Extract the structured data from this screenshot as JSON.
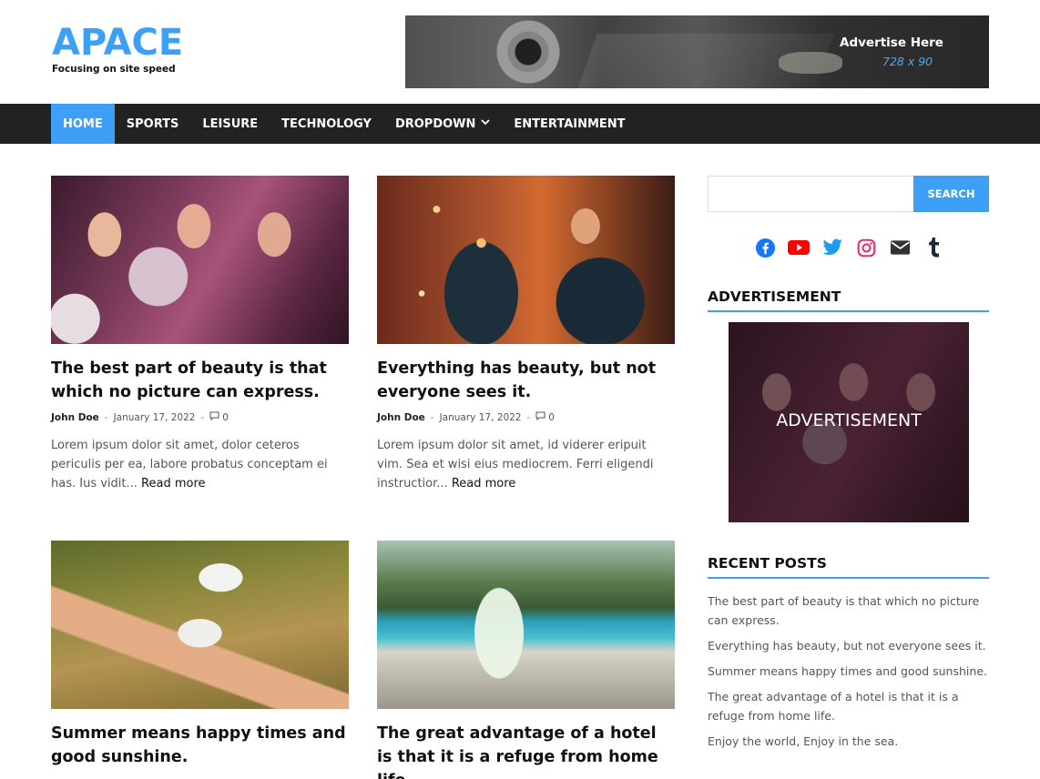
{
  "header": {
    "site_title": "APACE",
    "tagline": "Focusing on site speed",
    "ad_banner": {
      "title": "Advertise Here",
      "size": "728 x 90"
    }
  },
  "nav": {
    "items": [
      {
        "label": "HOME",
        "active": true
      },
      {
        "label": "SPORTS"
      },
      {
        "label": "LEISURE"
      },
      {
        "label": "TECHNOLOGY"
      },
      {
        "label": "DROPDOWN",
        "has_dropdown": true
      },
      {
        "label": "ENTERTAINMENT"
      }
    ],
    "active_color": "#3d9ff5"
  },
  "posts": [
    {
      "title": "The best part of beauty is that which no picture can express.",
      "author": "John Doe",
      "date": "January 17, 2022",
      "comments": "0",
      "excerpt": "Lorem ipsum dolor sit amet, dolor ceteros periculis per ea, labore probatus conceptam ei has. Ius vidit...",
      "read_more": "Read more"
    },
    {
      "title": "Everything has beauty, but not everyone sees it.",
      "author": "John Doe",
      "date": "January 17, 2022",
      "comments": "0",
      "excerpt": "Lorem ipsum dolor sit amet, id viderer eripuit vim. Sea et wisi eius mediocrem. Ferri eligendi instructior...",
      "read_more": "Read more"
    },
    {
      "title": "Summer means happy times and good sunshine."
    },
    {
      "title": "The great advantage of a hotel is that it is a refuge from home life."
    }
  ],
  "sidebar": {
    "search": {
      "placeholder": "",
      "button_label": "SEARCH"
    },
    "social_icons": [
      "facebook-icon",
      "youtube-icon",
      "twitter-icon",
      "instagram-icon",
      "email-icon",
      "tumblr-icon"
    ],
    "advertisement": {
      "heading": "ADVERTISEMENT",
      "box_text": "ADVERTISEMENT"
    },
    "recent_posts": {
      "heading": "RECENT POSTS",
      "items": [
        "The best part of beauty is that which no picture can express.",
        "Everything has beauty, but not everyone sees it.",
        "Summer means happy times and good sunshine.",
        "The great advantage of a hotel is that it is a refuge from home life.",
        "Enjoy the world, Enjoy in the sea."
      ]
    }
  },
  "colors": {
    "accent": "#3d9ff5",
    "nav_bg": "#222222"
  }
}
